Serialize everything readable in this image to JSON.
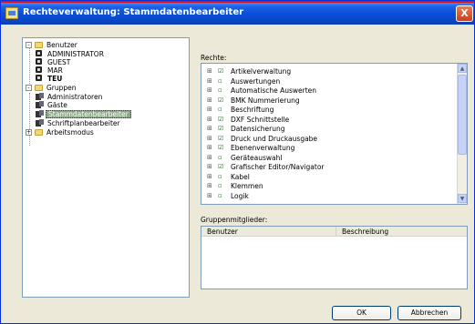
{
  "window": {
    "title": "Rechteverwaltung: Stammdatenbearbeiter",
    "close_glyph": "X"
  },
  "tree": {
    "users_group": "Benutzer",
    "users": [
      "ADMINISTRATOR",
      "GUEST",
      "MAR",
      "TEU"
    ],
    "groups_group": "Gruppen",
    "groups": [
      "Administratoren",
      "Gäste",
      "Stammdatenbearbeiter",
      "Schriftplanbearbeiter"
    ],
    "selected_group": "Stammdatenbearbeiter",
    "workspaces_group": "Arbeitsmodus",
    "expand_glyph": "+",
    "collapse_glyph": "-"
  },
  "rights": {
    "label": "Rechte:",
    "items": [
      {
        "label": "Artikelverwaltung",
        "checked": true
      },
      {
        "label": "Auswertungen",
        "checked": false
      },
      {
        "label": "Automatische Auswerten",
        "checked": false
      },
      {
        "label": "BMK Nummerierung",
        "checked": true
      },
      {
        "label": "Beschriftung",
        "checked": false
      },
      {
        "label": "DXF Schnittstelle",
        "checked": true
      },
      {
        "label": "Datensicherung",
        "checked": true
      },
      {
        "label": "Druck und Druckausgabe",
        "checked": true
      },
      {
        "label": "Ebenenverwaltung",
        "checked": true
      },
      {
        "label": "Geräteauswahl",
        "checked": false
      },
      {
        "label": "Grafischer Editor/Navigator",
        "checked": true
      },
      {
        "label": "Kabel",
        "checked": false
      },
      {
        "label": "Klemmen",
        "checked": false
      },
      {
        "label": "Logik",
        "checked": false
      }
    ],
    "plus_glyph": "⊞",
    "checked_glyph": "☑",
    "unchecked_glyph": "▫",
    "scroll_up_glyph": "▲",
    "scroll_down_glyph": "▼"
  },
  "members": {
    "label": "Gruppenmitglieder:",
    "columns": [
      "Benutzer",
      "Beschreibung"
    ]
  },
  "buttons": {
    "ok": "OK",
    "cancel": "Abbrechen"
  },
  "colors": {
    "titlebar": "#0a4fd8",
    "selection": "#8fa78a",
    "window_bg": "#ece9d8"
  }
}
